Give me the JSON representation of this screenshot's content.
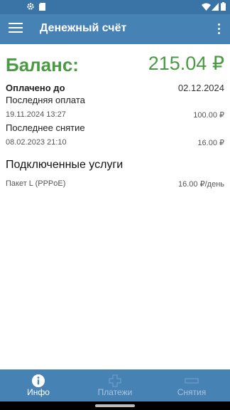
{
  "colors": {
    "app_bar": "#4682b4",
    "balance": "#4a9a43"
  },
  "app_bar": {
    "title": "Денежный счёт",
    "menu_icon": "menu-icon",
    "overflow_icon": "more-vert-icon"
  },
  "balance": {
    "label": "Баланс:",
    "value": "215.04 ₽"
  },
  "paid_until": {
    "label": "Оплачено до",
    "date": "02.12.2024"
  },
  "last_payment": {
    "label": "Последняя оплата",
    "datetime": "19.11.2024 13:27",
    "amount": "100.00 ₽"
  },
  "last_withdrawal": {
    "label": "Последнее снятие",
    "datetime": "08.02.2023 21:10",
    "amount": "16.00 ₽"
  },
  "services": {
    "title": "Подключенные услуги",
    "items": [
      {
        "name": "Пакет L (PPPoE)",
        "price": "16.00 ₽/день"
      }
    ]
  },
  "bottom_nav": {
    "items": [
      {
        "label": "Инфо",
        "icon": "info-icon",
        "active": true
      },
      {
        "label": "Платежи",
        "icon": "plus-icon",
        "active": false
      },
      {
        "label": "Снятия",
        "icon": "minus-icon",
        "active": false
      }
    ]
  }
}
